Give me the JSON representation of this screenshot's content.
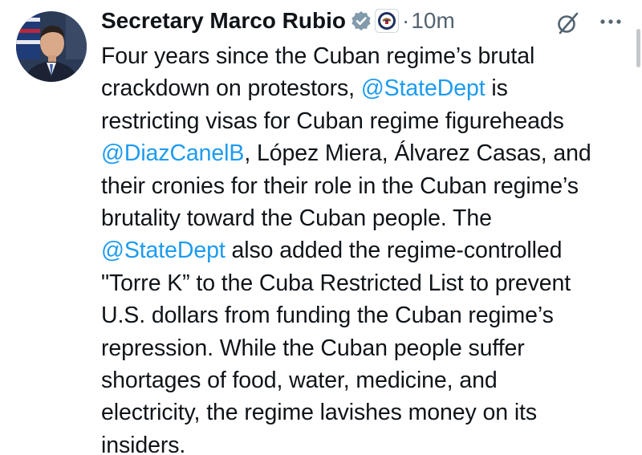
{
  "author": {
    "name": "Secretary Marco Rubio",
    "timestamp_separator": "·",
    "timestamp": "10m",
    "verified_icon": "verified-check-badge",
    "affiliation_icon": "us-department-of-state-seal"
  },
  "actions": {
    "grok_icon": "grok-slash-icon",
    "more_icon": "more-dots-icon"
  },
  "tweet": {
    "lines": [
      [
        {
          "t": "Four years since the Cuban regime’s brutal"
        }
      ],
      [
        {
          "t": "crackdown on protestors, "
        },
        {
          "m": "@StateDept"
        },
        {
          "t": " is"
        }
      ],
      [
        {
          "t": "restricting visas for Cuban regime figureheads"
        }
      ],
      [
        {
          "m": "@DiazCanelB"
        },
        {
          "t": ", López Miera, Álvarez Casas, and"
        }
      ],
      [
        {
          "t": "their cronies for their role in the Cuban regime’s"
        }
      ],
      [
        {
          "t": "brutality toward the Cuban people. The"
        }
      ],
      [
        {
          "m": "@StateDept"
        },
        {
          "t": " also added the regime-controlled"
        }
      ],
      [
        {
          "t": "\"Torre K” to the Cuba Restricted List to prevent"
        }
      ],
      [
        {
          "t": "U.S. dollars from funding the Cuban regime’s"
        }
      ],
      [
        {
          "t": "repression. While the Cuban people suffer"
        }
      ],
      [
        {
          "t": "shortages of food, water, medicine, and"
        }
      ],
      [
        {
          "t": "electricity, the regime lavishes money on its"
        }
      ],
      [
        {
          "t": "insiders."
        }
      ]
    ]
  },
  "colors": {
    "text": "#0f1419",
    "muted": "#536471",
    "link": "#1d9bf0",
    "verified": "#829aab"
  }
}
